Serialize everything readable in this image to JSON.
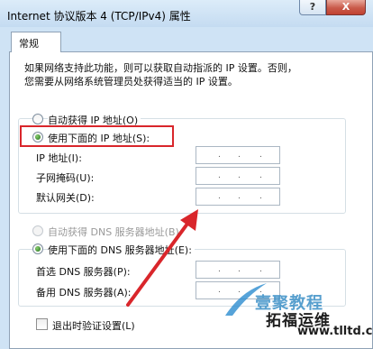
{
  "window": {
    "title": "Internet 协议版本 4 (TCP/IPv4) 属性",
    "help_label": "?",
    "close_label": "X"
  },
  "tabs": [
    {
      "label": "常规",
      "active": true
    }
  ],
  "description": {
    "line1": "如果网络支持此功能，则可以获取自动指派的 IP 设置。否则，",
    "line2": "您需要从网络系统管理员处获得适当的 IP 设置。"
  },
  "ip_section": {
    "auto_label": "自动获得 IP 地址(O)",
    "manual_label": "使用下面的 IP 地址(S):",
    "selected": "manual",
    "fields": [
      {
        "label": "IP 地址(I):",
        "value": ". . ."
      },
      {
        "label": "子网掩码(U):",
        "value": ". . ."
      },
      {
        "label": "默认网关(D):",
        "value": ". . ."
      }
    ]
  },
  "dns_section": {
    "auto_label": "自动获得 DNS 服务器地址(B)",
    "manual_label": "使用下面的 DNS 服务器地址(E):",
    "selected": "manual",
    "auto_disabled": true,
    "fields": [
      {
        "label": "首选 DNS 服务器(P):",
        "value": ". . ."
      },
      {
        "label": "备用 DNS 服务器(A):",
        "value": ". . ."
      }
    ]
  },
  "validate_checkbox": {
    "label": "退出时验证设置(L)",
    "checked": false
  },
  "watermark": {
    "line1": "壹聚教程",
    "line2": "拓福运维",
    "url": "www.tlltd.cn"
  },
  "colors": {
    "highlight_box": "#d9262b",
    "arrow": "#d9262b",
    "titlebar": "#c4dbf1"
  }
}
